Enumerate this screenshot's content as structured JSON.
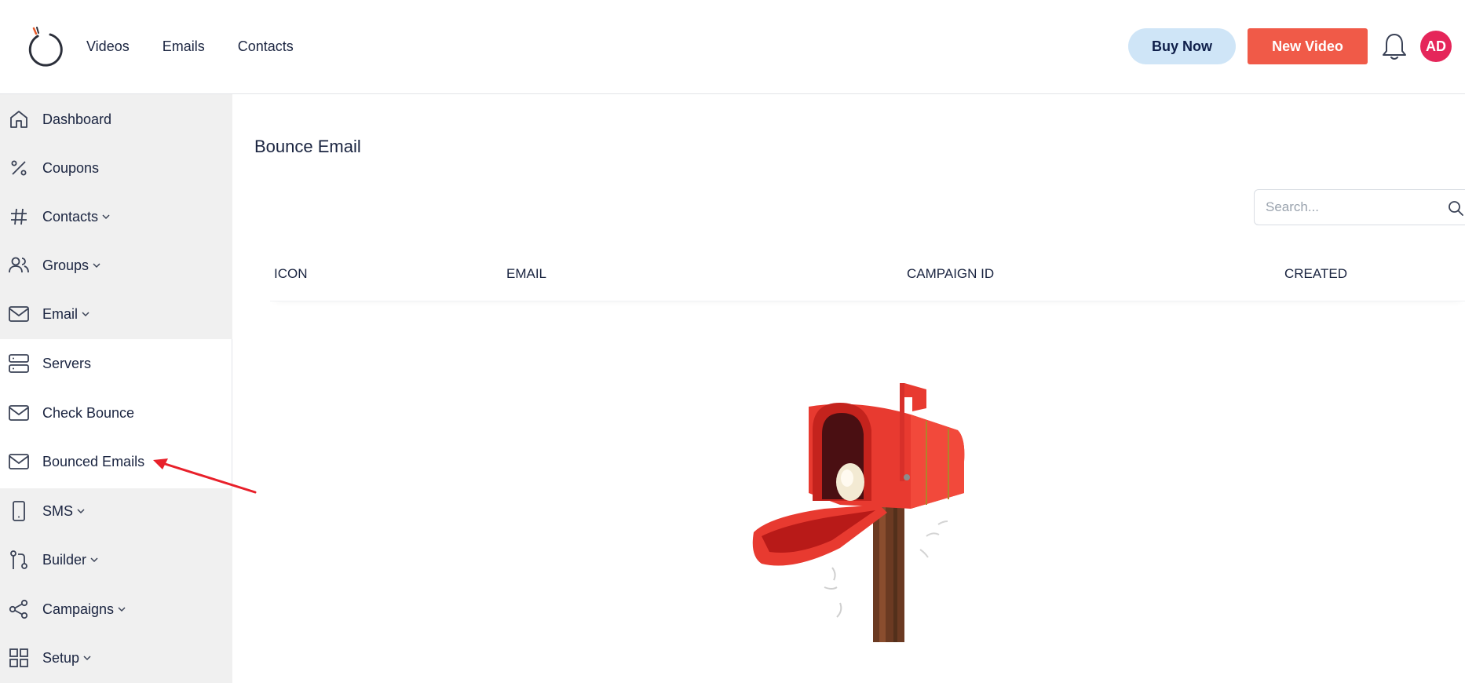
{
  "topbar": {
    "nav": [
      "Videos",
      "Emails",
      "Contacts"
    ],
    "buy_now": "Buy Now",
    "new_video": "New Video",
    "avatar_initials": "AD",
    "icons": {
      "logo": "app-logo-icon",
      "notifications": "bell-icon"
    }
  },
  "sidebar": {
    "items": [
      {
        "label": "Dashboard",
        "icon": "home-icon",
        "dropdown": false
      },
      {
        "label": "Coupons",
        "icon": "percent-icon",
        "dropdown": false
      },
      {
        "label": "Contacts",
        "icon": "hash-icon",
        "dropdown": true
      },
      {
        "label": "Groups",
        "icon": "users-icon",
        "dropdown": true
      },
      {
        "label": "Email",
        "icon": "mail-icon",
        "dropdown": true
      },
      {
        "label": "Servers",
        "icon": "server-icon",
        "dropdown": false
      },
      {
        "label": "Check Bounce",
        "icon": "mail-icon",
        "dropdown": false
      },
      {
        "label": "Bounced Emails",
        "icon": "mail-icon",
        "dropdown": false
      },
      {
        "label": "SMS",
        "icon": "phone-icon",
        "dropdown": true
      },
      {
        "label": "Builder",
        "icon": "git-pull-icon",
        "dropdown": true
      },
      {
        "label": "Campaigns",
        "icon": "share-icon",
        "dropdown": true
      },
      {
        "label": "Setup",
        "icon": "grid-icon",
        "dropdown": true
      }
    ]
  },
  "main": {
    "title": "Bounce Email",
    "search": {
      "placeholder": "Search...",
      "value": ""
    },
    "table": {
      "columns": [
        "ICON",
        "EMAIL",
        "CAMPAIGN ID",
        "CREATED"
      ],
      "rows": []
    },
    "empty_state_icon": "empty-mailbox-illustration"
  },
  "colors": {
    "accent_red": "#f05a48",
    "buy_now_bg": "#cfe5f7",
    "avatar_bg": "#e5265a",
    "sidebar_grey": "#f0f0f0",
    "annotation_arrow": "#e8202a"
  }
}
